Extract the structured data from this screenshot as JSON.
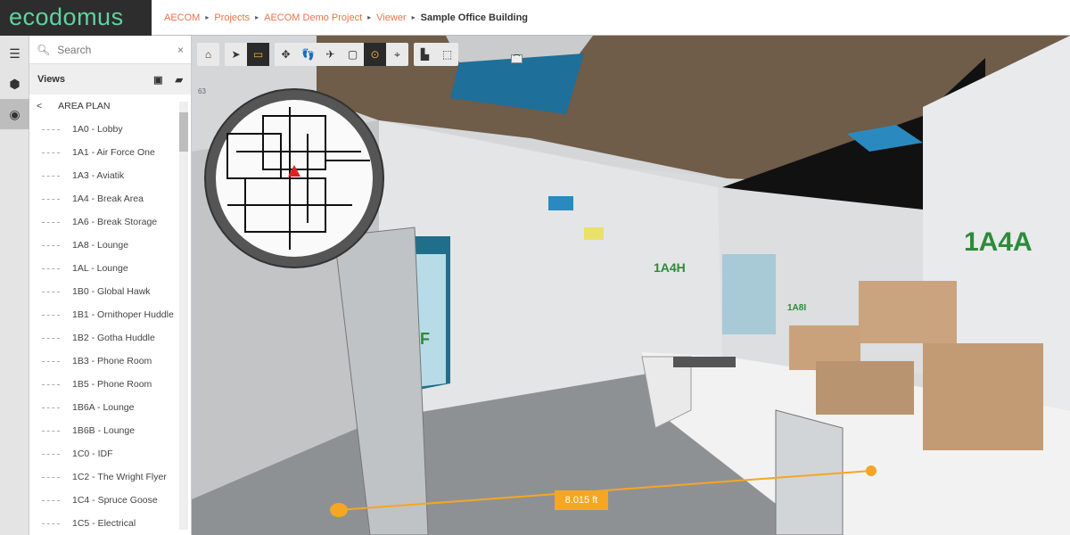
{
  "header": {
    "logo": "ecodomus",
    "breadcrumb": [
      "AECOM",
      "Projects",
      "AECOM Demo Project",
      "Viewer"
    ],
    "current": "Sample Office Building",
    "sep": "▸"
  },
  "rail": [
    {
      "icon": "menu-icon",
      "glyph": "☰"
    },
    {
      "icon": "cube-icon",
      "glyph": "⬢"
    },
    {
      "icon": "eye-icon",
      "glyph": "◉"
    }
  ],
  "panel": {
    "search_placeholder": "Search",
    "clear": "×",
    "views_title": "Views",
    "back": "<",
    "section": "AREA PLAN",
    "items": [
      "1A0 - Lobby",
      "1A1 - Air Force One",
      "1A3 - Aviatik",
      "1A4 - Break Area",
      "1A6 - Break Storage",
      "1A8 - Lounge",
      "1AL - Lounge",
      "1B0 - Global Hawk",
      "1B1 - Ornithoper Huddle",
      "1B2 - Gotha Huddle",
      "1B3 - Phone Room",
      "1B5 - Phone Room",
      "1B6A - Lounge",
      "1B6B - Lounge",
      "1C0 - IDF",
      "1C2 - The Wright Flyer",
      "1C4 - Spruce Goose",
      "1C5 - Electrical"
    ]
  },
  "toolbar": {
    "groups": [
      [
        {
          "icon": "home-icon",
          "glyph": "⌂"
        }
      ],
      [
        {
          "icon": "select-arrow-icon",
          "glyph": "➤"
        },
        {
          "icon": "measure-ruler-icon",
          "glyph": "▭",
          "active": true
        }
      ],
      [
        {
          "icon": "pan-move-icon",
          "glyph": "✥"
        },
        {
          "icon": "walk-footsteps-icon",
          "glyph": "👣"
        },
        {
          "icon": "fly-airplane-icon",
          "glyph": "✈"
        },
        {
          "icon": "section-box-icon",
          "glyph": "▢"
        },
        {
          "icon": "camera-orbit-icon",
          "glyph": "⊙",
          "active": true
        },
        {
          "icon": "locate-icon",
          "glyph": "⌖"
        }
      ],
      [
        {
          "icon": "add-document-icon",
          "glyph": "▙"
        },
        {
          "icon": "select-window-icon",
          "glyph": "⬚"
        }
      ]
    ]
  },
  "viewer": {
    "fps": "63",
    "room_labels": [
      "1A4H",
      "1A4A",
      "1A8I",
      "F"
    ],
    "measurement": "8.015 ft",
    "accent": "#f5a623"
  }
}
